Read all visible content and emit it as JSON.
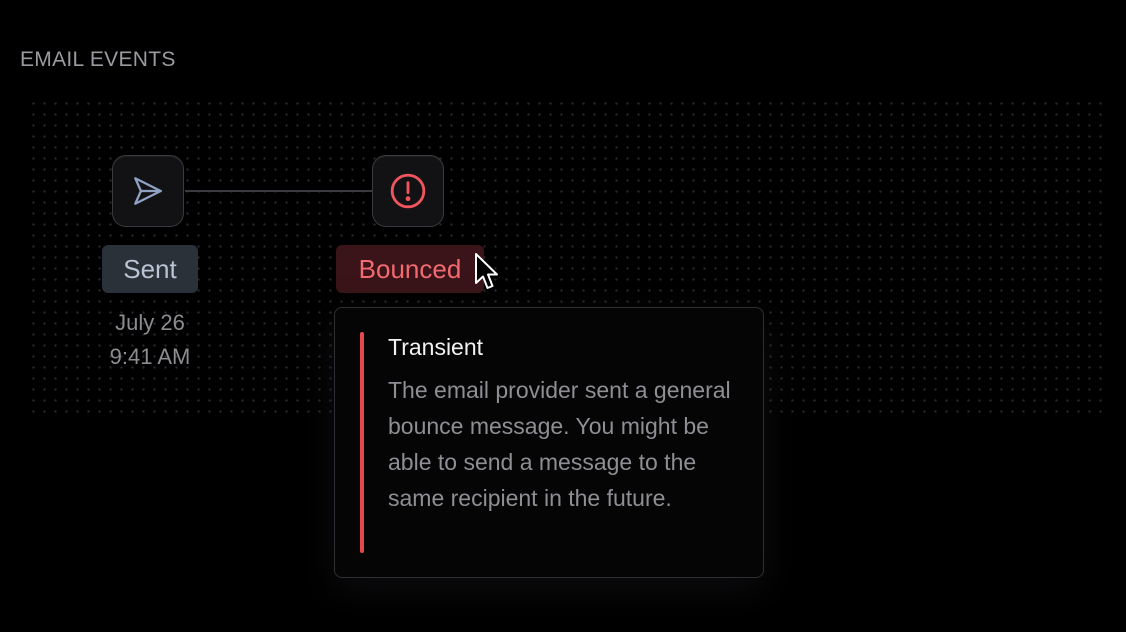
{
  "section": {
    "title": "EMAIL EVENTS"
  },
  "events": [
    {
      "label": "Sent",
      "icon": "send-icon",
      "date": "July 26",
      "time": "9:41 AM"
    },
    {
      "label": "Bounced",
      "icon": "alert-circle-icon"
    }
  ],
  "tooltip": {
    "title": "Transient",
    "body": "The email provider sent a general bounce message. You might be able to send a message to the same recipient in the future."
  },
  "colors": {
    "background": "#000000",
    "sent_badge_bg": "#2b3139",
    "sent_badge_text": "#b9c4d4",
    "bounced_badge_bg": "#3a1418",
    "bounced_accent": "#e5484d",
    "bounced_text": "#f26a72"
  }
}
